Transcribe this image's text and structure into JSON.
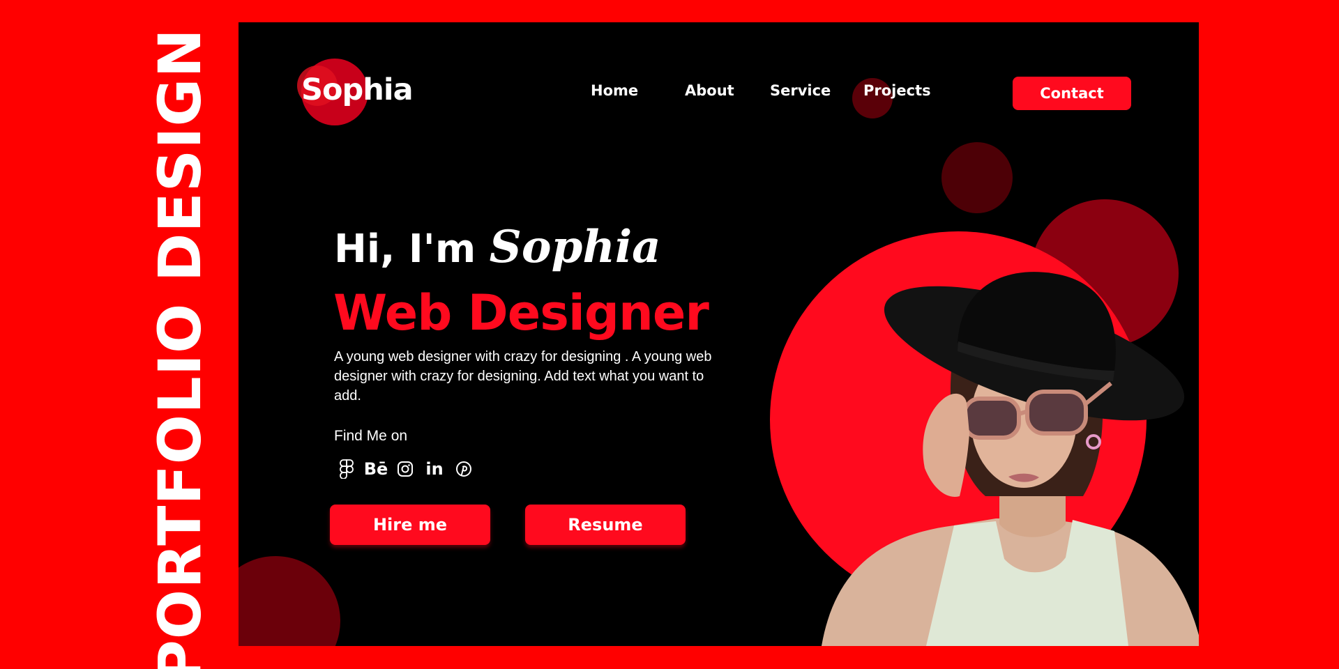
{
  "side_title": "PORTFOLIO DESIGN",
  "header": {
    "logo": "Sophia",
    "nav": [
      {
        "label": "Home"
      },
      {
        "label": "About"
      },
      {
        "label": "Service"
      },
      {
        "label": "Projects"
      }
    ],
    "contact_label": "Contact"
  },
  "hero": {
    "greeting": "Hi, I'm",
    "name": "Sophia",
    "role": "Web Designer",
    "bio": "A young web designer with crazy for designing . A young web designer with crazy for designing. Add text what you want to add.",
    "find_label": "Find Me on",
    "socials": [
      {
        "icon": "figma-icon"
      },
      {
        "icon": "behance-icon",
        "text": "Bē"
      },
      {
        "icon": "instagram-icon"
      },
      {
        "icon": "linkedin-icon",
        "text": "in"
      },
      {
        "icon": "pinterest-icon"
      }
    ],
    "buttons": {
      "hire_label": "Hire me",
      "resume_label": "Resume"
    }
  },
  "colors": {
    "background": "#ff0000",
    "panel": "#000000",
    "accent": "#ff0a1e",
    "text": "#ffffff"
  }
}
